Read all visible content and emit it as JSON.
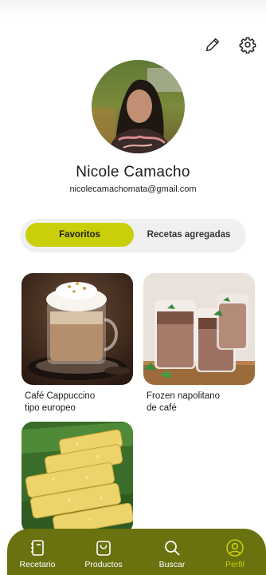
{
  "header": {
    "edit_icon": "pencil-icon",
    "settings_icon": "gear-icon"
  },
  "profile": {
    "name": "Nicole Camacho",
    "email": "nicolecamachomata@gmail.com"
  },
  "tabs": [
    {
      "label": "Favoritos",
      "active": true
    },
    {
      "label": "Recetas agregadas",
      "active": false
    }
  ],
  "recipes": [
    {
      "title": "Café Cappuccino\ntipo europeo"
    },
    {
      "title": "Frozen napolitano\nde café"
    },
    {
      "title": ""
    }
  ],
  "nav": {
    "items": [
      {
        "label": "Recetario",
        "icon": "book-icon"
      },
      {
        "label": "Productos",
        "icon": "shopping-bag-icon"
      },
      {
        "label": "Buscar",
        "icon": "search-icon"
      },
      {
        "label": "Perfil",
        "icon": "user-icon"
      }
    ],
    "active_index": 3
  },
  "colors": {
    "accent": "#c9cf0a",
    "nav_background": "#69720e",
    "tab_background": "#f0f0f0"
  }
}
